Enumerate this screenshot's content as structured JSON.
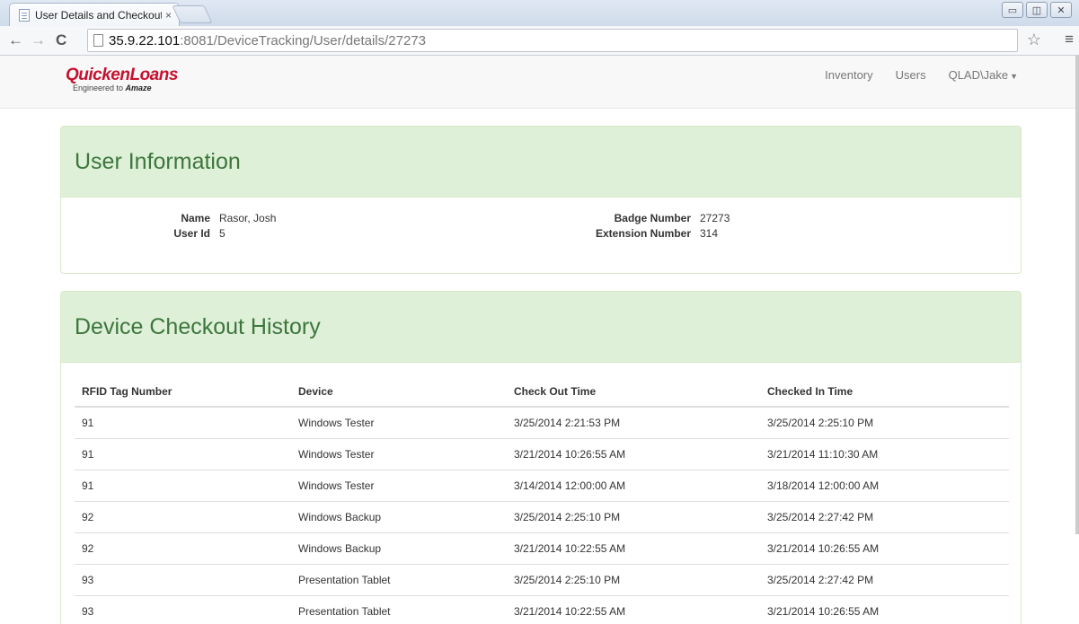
{
  "browser": {
    "tab_title": "User Details and Checkout",
    "tab_close": "×",
    "url_host": "35.9.22.101",
    "url_rest": ":8081/DeviceTracking/User/details/27273",
    "window_controls": [
      "▭",
      "◫",
      "✕"
    ]
  },
  "navbar": {
    "brand": "QuickenLoans",
    "tagline_prefix": "Engineered to ",
    "tagline_emphasis": "Amaze",
    "links": [
      "Inventory",
      "Users",
      "QLAD\\Jake"
    ]
  },
  "user_info": {
    "title": "User Information",
    "left": [
      {
        "term": "Name",
        "value": "Rasor, Josh"
      },
      {
        "term": "User Id",
        "value": "5"
      }
    ],
    "right": [
      {
        "term": "Badge Number",
        "value": "27273"
      },
      {
        "term": "Extension Number",
        "value": "314"
      }
    ]
  },
  "history": {
    "title": "Device Checkout History",
    "columns": [
      "RFID Tag Number",
      "Device",
      "Check Out Time",
      "Checked In Time"
    ],
    "rows": [
      [
        "91",
        "Windows Tester",
        "3/25/2014 2:21:53 PM",
        "3/25/2014 2:25:10 PM"
      ],
      [
        "91",
        "Windows Tester",
        "3/21/2014 10:26:55 AM",
        "3/21/2014 11:10:30 AM"
      ],
      [
        "91",
        "Windows Tester",
        "3/14/2014 12:00:00 AM",
        "3/18/2014 12:00:00 AM"
      ],
      [
        "92",
        "Windows Backup",
        "3/25/2014 2:25:10 PM",
        "3/25/2014 2:27:42 PM"
      ],
      [
        "92",
        "Windows Backup",
        "3/21/2014 10:22:55 AM",
        "3/21/2014 10:26:55 AM"
      ],
      [
        "93",
        "Presentation Tablet",
        "3/25/2014 2:25:10 PM",
        "3/25/2014 2:27:42 PM"
      ],
      [
        "93",
        "Presentation Tablet",
        "3/21/2014 10:22:55 AM",
        "3/21/2014 10:26:55 AM"
      ]
    ]
  }
}
